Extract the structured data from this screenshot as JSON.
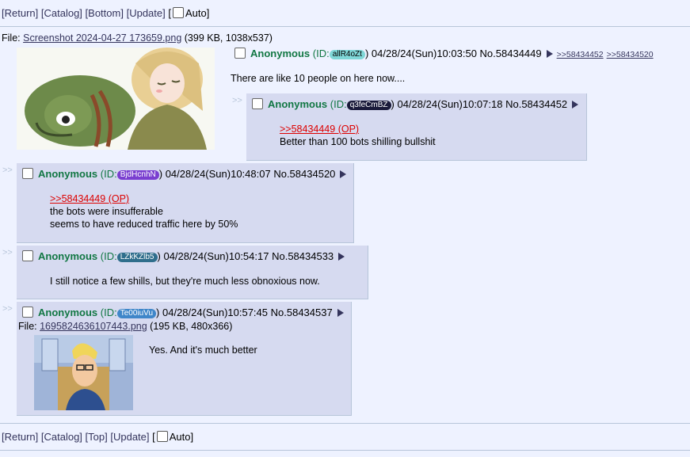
{
  "nav": {
    "return": "[Return]",
    "catalog": "[Catalog]",
    "bottom": "[Bottom]",
    "top": "[Top]",
    "update": "[Update]",
    "bracket_open": "[",
    "auto": "Auto]"
  },
  "op": {
    "file_label": "File:",
    "file_name": "Screenshot 2024-04-27 173659.png",
    "file_meta": "(399 KB, 1038x537)",
    "name": "Anonymous",
    "id_prefix": "(ID:",
    "id": "allR4oZt",
    "id_suffix": ")",
    "datetime": "04/28/24(Sun)10:03:50",
    "no": "No.58434449",
    "backlinks": [
      ">>58434452",
      ">>58434520"
    ],
    "message": "There are like 10 people on here now...."
  },
  "replies": [
    {
      "name": "Anonymous",
      "id": "q3feCmBZ",
      "id_color": "#1a1a3a",
      "datetime": "04/28/24(Sun)10:07:18",
      "no": "No.58434452",
      "quote": ">>58434449 (OP)",
      "lines": [
        "Better than 100 bots shilling bullshit"
      ]
    },
    {
      "name": "Anonymous",
      "id": "BjdHcnhN",
      "id_color": "#7a3fd0",
      "datetime": "04/28/24(Sun)10:48:07",
      "no": "No.58434520",
      "quote": ">>58434449 (OP)",
      "lines": [
        "the bots were insufferable",
        "seems to have reduced traffic here by 50%"
      ]
    },
    {
      "name": "Anonymous",
      "id": "LZkKZlb5",
      "id_color": "#2f6e8c",
      "datetime": "04/28/24(Sun)10:54:17",
      "no": "No.58434533",
      "lines": [
        "I still notice a few shills, but they're much less obnoxious now."
      ]
    },
    {
      "name": "Anonymous",
      "id": "Te00iuVu",
      "id_color": "#3f86c9",
      "datetime": "04/28/24(Sun)10:57:45",
      "no": "No.58434537",
      "file_label": "File:",
      "file_name": "1695824636107443.png",
      "file_meta": "(195 KB, 480x366)",
      "lines": [
        "Yes. And it's much better"
      ]
    }
  ],
  "colors": {
    "background": "#eef2ff",
    "reply_bg": "#d6daf0",
    "name": "#117743",
    "quotelink": "#dd0000",
    "op_id": "#7fd7d7"
  },
  "side_arrows": ">>"
}
